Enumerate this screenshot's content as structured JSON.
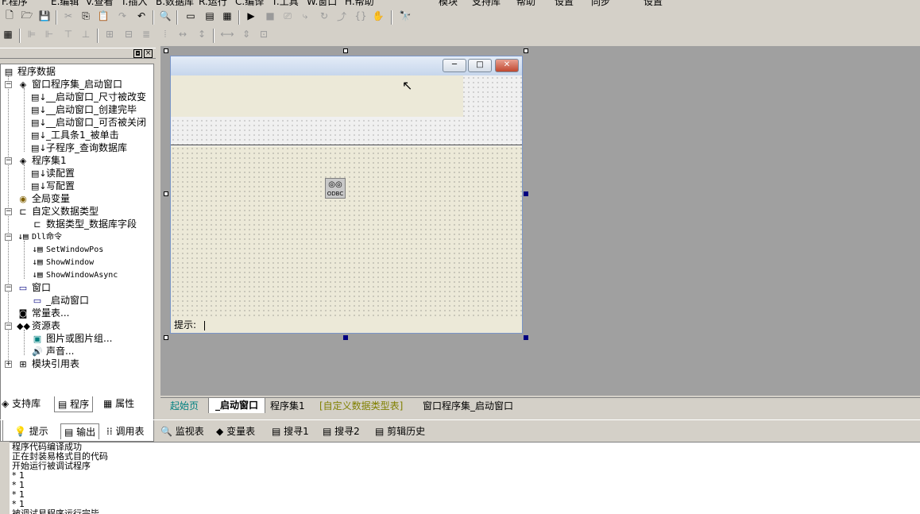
{
  "menu": [
    "F.程序",
    "E.编辑",
    "V.查看",
    "I.插入",
    "B.数据库",
    "R.运行",
    "C.编译",
    "T.工具",
    "W.窗口",
    "H.帮助",
    "模块",
    "支持库",
    "帮助",
    "设置",
    "同步",
    "设置"
  ],
  "panel": {
    "tree": [
      {
        "label": "程序数据",
        "level": 0
      },
      {
        "label": "窗口程序集_启动窗口",
        "level": 1
      },
      {
        "label": "__启动窗口_尺寸被改变",
        "level": 2
      },
      {
        "label": "__启动窗口_创建完毕",
        "level": 2
      },
      {
        "label": "__启动窗口_可否被关闭",
        "level": 2
      },
      {
        "label": "_工具条1_被单击",
        "level": 2
      },
      {
        "label": "子程序_查询数据库",
        "level": 2
      },
      {
        "label": "程序集1",
        "level": 1
      },
      {
        "label": "读配置",
        "level": 2
      },
      {
        "label": "写配置",
        "level": 2
      },
      {
        "label": "全局变量",
        "level": 1
      },
      {
        "label": "自定义数据类型",
        "level": 1
      },
      {
        "label": "数据类型_数据库字段",
        "level": 2
      },
      {
        "label": "Dll命令",
        "level": 1
      },
      {
        "label": "SetWindowPos",
        "level": 2
      },
      {
        "label": "ShowWindow",
        "level": 2
      },
      {
        "label": "ShowWindowAsync",
        "level": 2
      },
      {
        "label": "窗口",
        "level": 1
      },
      {
        "label": "_启动窗口",
        "level": 2
      },
      {
        "label": "常量表...",
        "level": 1
      },
      {
        "label": "资源表",
        "level": 1
      },
      {
        "label": "图片或图片组...",
        "level": 2
      },
      {
        "label": "声音...",
        "level": 2
      },
      {
        "label": "模块引用表",
        "level": 1
      }
    ],
    "tabs": [
      "支持库",
      "程序",
      "属性"
    ]
  },
  "form": {
    "status_label": "提示:",
    "odbc_label": "ODBC",
    "min": "─",
    "max": "□",
    "close": "✕"
  },
  "editor_tabs": [
    "起始页",
    "_启动窗口",
    "程序集1",
    "[自定义数据类型表]",
    "窗口程序集_启动窗口"
  ],
  "output_tabs": [
    "提示",
    "输出",
    "调用表",
    "监视表",
    "变量表",
    "搜寻1",
    "搜寻2",
    "剪辑历史"
  ],
  "output_text": "程序代码编译成功\n正在封装易格式目的代码\n开始运行被调试程序\n* 1\n* 1\n* 1\n* 1\n被调试易程序运行完毕",
  "colors": {
    "accent": "#000080",
    "close": "#c04830",
    "yellow_tab": "#808000",
    "blue_tab": "#008080"
  }
}
